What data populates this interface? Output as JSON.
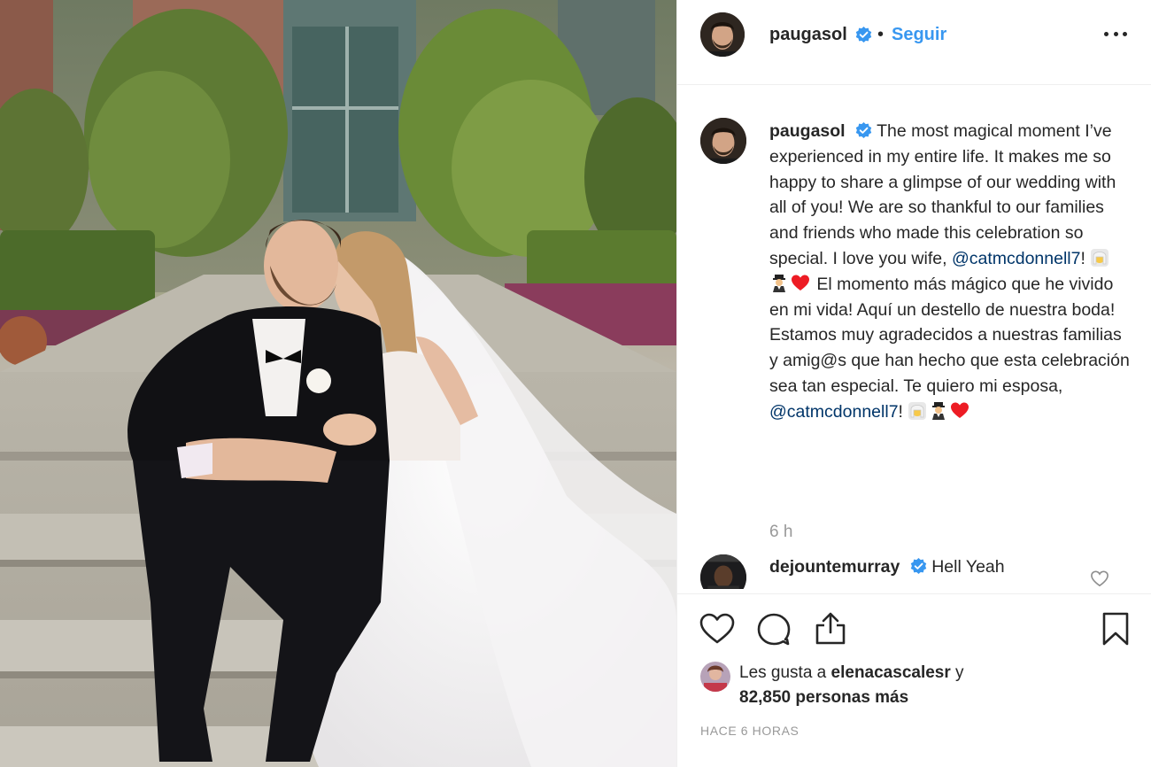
{
  "post": {
    "image_alt": "Wedding photo of couple sitting on garden steps"
  },
  "header": {
    "username": "paugasol",
    "dot": "•",
    "follow_label": "Seguir",
    "more_icon": "more-options-icon"
  },
  "caption": {
    "username": "paugasol",
    "text_part1": " The most magical moment I’ve experienced in my entire life. It makes me so happy to share a glimpse of our wedding with all of you! We are so thankful to our families and friends who made this celebration so special. I love you wife, ",
    "mention1": "@catmcdonnell7",
    "bang1": "! ",
    "text_part2": " El momento más mágico que he vivido en mi vida! Aquí un destello de nuestra boda! Estamos muy agradecidos a nuestras familias y amig@s que han hecho que esta celebración sea tan especial. Te quiero mi esposa, ",
    "mention2": "@catmcdonnell7",
    "bang2": "! ",
    "time": "6 h"
  },
  "comment": {
    "username": "dejountemurray",
    "text": " Hell Yeah"
  },
  "likes": {
    "prefix": "Les gusta a ",
    "user": "elenacascalesr",
    "suffix": " y",
    "count": "82,850",
    "count_suffix": " personas más"
  },
  "timestamp": "HACE 6 HORAS",
  "colors": {
    "link_blue": "#3897f0",
    "mention_blue": "#003569",
    "verified_blue": "#3897f0",
    "heart_red": "#ed1c24"
  }
}
